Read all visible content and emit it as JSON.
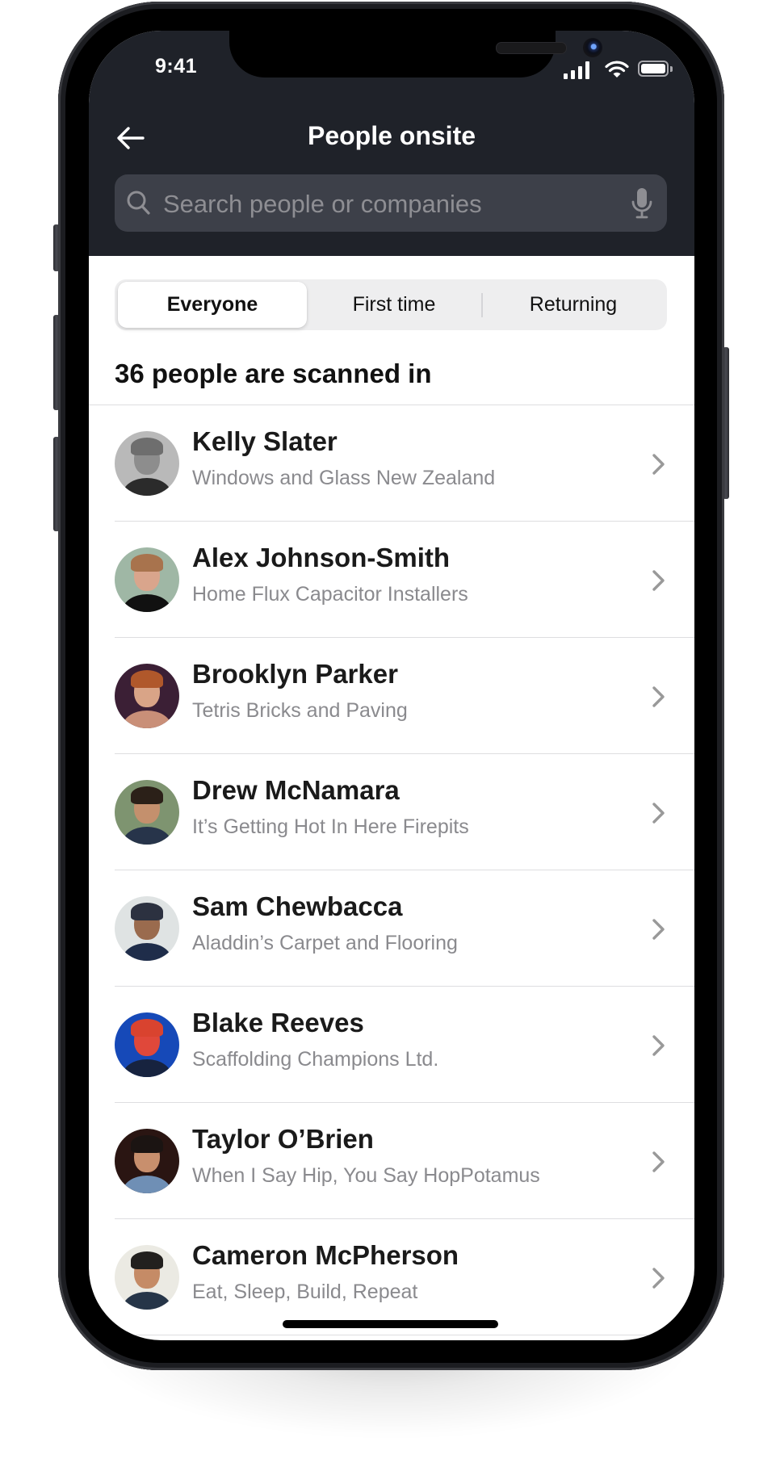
{
  "status_bar": {
    "time": "9:41",
    "icons": [
      "cellular-signal-icon",
      "wifi-icon",
      "battery-icon"
    ]
  },
  "header": {
    "back_icon": "arrow-left-icon",
    "title": "People onsite"
  },
  "search": {
    "placeholder": "Search people or companies",
    "value": "",
    "left_icon": "search-icon",
    "right_icon": "microphone-icon"
  },
  "filter_tabs": {
    "selected": "Everyone",
    "items": [
      {
        "label": "Everyone",
        "active": true
      },
      {
        "label": "First time",
        "active": false
      },
      {
        "label": "Returning",
        "active": false
      }
    ]
  },
  "count_heading": "36 people are scanned in",
  "people": [
    {
      "name": "Kelly Slater",
      "company": "Windows and Glass New Zealand",
      "avatar_colors": {
        "bg": "#b9b9b9",
        "skin": "#8d8d8d",
        "hair": "#6e6e6e",
        "shirt": "#2b2b2b"
      }
    },
    {
      "name": "Alex Johnson-Smith",
      "company": "Home Flux Capacitor Installers",
      "avatar_colors": {
        "bg": "#9fb7a5",
        "skin": "#d9a58c",
        "hair": "#a8734d",
        "shirt": "#111111"
      }
    },
    {
      "name": "Brooklyn Parker",
      "company": "Tetris Bricks and Paving",
      "avatar_colors": {
        "bg": "#3b1f35",
        "skin": "#d9a487",
        "hair": "#b0582b",
        "shirt": "#c98f78"
      }
    },
    {
      "name": "Drew McNamara",
      "company": "It’s Getting Hot In Here Firepits",
      "avatar_colors": {
        "bg": "#7e9470",
        "skin": "#c4906d",
        "hair": "#2b2018",
        "shirt": "#27344a"
      }
    },
    {
      "name": "Sam Chewbacca",
      "company": "Aladdin’s Carpet and Flooring",
      "avatar_colors": {
        "bg": "#dfe3e3",
        "skin": "#9a6b4e",
        "hair": "#2c3140",
        "shirt": "#1f2d4a"
      }
    },
    {
      "name": "Blake Reeves",
      "company": "Scaffolding Champions Ltd.",
      "avatar_colors": {
        "bg": "#1649b8",
        "skin": "#e0483a",
        "hair": "#d9432f",
        "shirt": "#17233f"
      }
    },
    {
      "name": "Taylor O’Brien",
      "company": "When I Say Hip, You Say HopPotamus",
      "avatar_colors": {
        "bg": "#2a1512",
        "skin": "#c88f6d",
        "hair": "#1b1412",
        "shirt": "#6f8fb5"
      }
    },
    {
      "name": "Cameron McPherson",
      "company": "Eat, Sleep, Build, Repeat",
      "avatar_colors": {
        "bg": "#ebeae3",
        "skin": "#c58b66",
        "hair": "#22201e",
        "shirt": "#263548"
      }
    }
  ],
  "colors": {
    "header_bg": "#1f2229",
    "search_bg": "#3d4049",
    "placeholder": "#8e8e93",
    "secondary_text": "#8a8a8e",
    "chevron": "#999999"
  }
}
